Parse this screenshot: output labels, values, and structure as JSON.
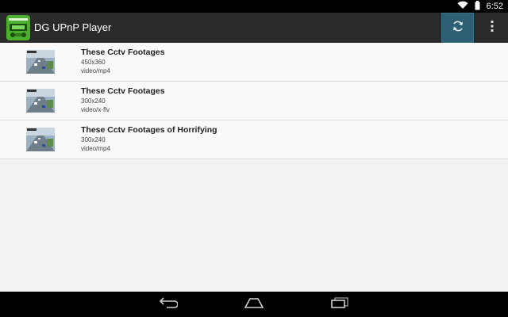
{
  "status_bar": {
    "time": "6:52",
    "icons": [
      "wifi-icon",
      "battery-icon"
    ]
  },
  "action_bar": {
    "title": "DG UPnP Player",
    "app_icon": "app-logo-icon",
    "refresh_icon": "refresh-icon",
    "overflow_icon": "overflow-menu-icon",
    "accent_color": "#2f5f74"
  },
  "items": [
    {
      "title": "These Cctv Footages",
      "size": "450x360",
      "type": "video/mp4"
    },
    {
      "title": "These Cctv Footages",
      "size": "300x240",
      "type": "video/x-flv"
    },
    {
      "title": "These Cctv Footages of Horrifying",
      "size": "300x240",
      "type": "video/mp4"
    }
  ],
  "nav_bar": {
    "back_icon": "back-icon",
    "home_icon": "home-icon",
    "recents_icon": "recent-apps-icon"
  }
}
